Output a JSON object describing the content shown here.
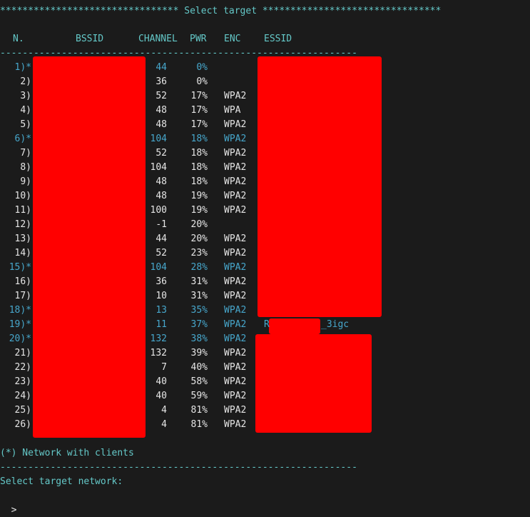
{
  "title": "******************************** Select target ********************************",
  "header": {
    "n": "N.",
    "bssid": "BSSID",
    "channel": "CHANNEL",
    "pwr": "PWR",
    "enc": "ENC",
    "essid": "ESSID"
  },
  "divider": "----------------------------------------------------------------",
  "rows": [
    {
      "n": "1)*",
      "channel": "44",
      "pwr": "0%",
      "enc": "",
      "clients": true
    },
    {
      "n": "2)",
      "channel": "36",
      "pwr": "0%",
      "enc": "",
      "clients": false
    },
    {
      "n": "3)",
      "channel": "52",
      "pwr": "17%",
      "enc": "WPA2",
      "clients": false
    },
    {
      "n": "4)",
      "channel": "48",
      "pwr": "17%",
      "enc": "WPA",
      "clients": false
    },
    {
      "n": "5)",
      "channel": "48",
      "pwr": "17%",
      "enc": "WPA2",
      "clients": false
    },
    {
      "n": "6)*",
      "channel": "104",
      "pwr": "18%",
      "enc": "WPA2",
      "clients": true
    },
    {
      "n": "7)",
      "channel": "52",
      "pwr": "18%",
      "enc": "WPA2",
      "clients": false
    },
    {
      "n": "8)",
      "channel": "104",
      "pwr": "18%",
      "enc": "WPA2",
      "clients": false
    },
    {
      "n": "9)",
      "channel": "48",
      "pwr": "18%",
      "enc": "WPA2",
      "clients": false
    },
    {
      "n": "10)",
      "channel": "48",
      "pwr": "19%",
      "enc": "WPA2",
      "clients": false
    },
    {
      "n": "11)",
      "channel": "100",
      "pwr": "19%",
      "enc": "WPA2",
      "clients": false
    },
    {
      "n": "12)",
      "channel": "-1",
      "pwr": "20%",
      "enc": "",
      "clients": false
    },
    {
      "n": "13)",
      "channel": "44",
      "pwr": "20%",
      "enc": "WPA2",
      "clients": false
    },
    {
      "n": "14)",
      "channel": "52",
      "pwr": "23%",
      "enc": "WPA2",
      "clients": false
    },
    {
      "n": "15)*",
      "channel": "104",
      "pwr": "28%",
      "enc": "WPA2",
      "clients": true
    },
    {
      "n": "16)",
      "channel": "36",
      "pwr": "31%",
      "enc": "WPA2",
      "clients": false
    },
    {
      "n": "17)",
      "channel": "10",
      "pwr": "31%",
      "enc": "WPA2",
      "clients": false
    },
    {
      "n": "18)*",
      "channel": "13",
      "pwr": "35%",
      "enc": "WPA2",
      "clients": true
    },
    {
      "n": "19)*",
      "channel": "11",
      "pwr": "37%",
      "enc": "WPA2",
      "clients": true,
      "essid_start": "R",
      "essid_end": "_3igc"
    },
    {
      "n": "20)*",
      "channel": "132",
      "pwr": "38%",
      "enc": "WPA2",
      "clients": true
    },
    {
      "n": "21)",
      "channel": "132",
      "pwr": "39%",
      "enc": "WPA2",
      "clients": false
    },
    {
      "n": "22)",
      "channel": "7",
      "pwr": "40%",
      "enc": "WPA2",
      "clients": false
    },
    {
      "n": "23)",
      "channel": "40",
      "pwr": "58%",
      "enc": "WPA2",
      "clients": false
    },
    {
      "n": "24)",
      "channel": "40",
      "pwr": "59%",
      "enc": "WPA2",
      "clients": false
    },
    {
      "n": "25)",
      "channel": "4",
      "pwr": "81%",
      "enc": "WPA2",
      "clients": false
    },
    {
      "n": "26)",
      "channel": "4",
      "pwr": "81%",
      "enc": "WPA2",
      "clients": false
    }
  ],
  "legend": "(*) Network with clients",
  "prompt": "Select target network:",
  "input_caret": ">",
  "colors": {
    "background": "#1b1b1b",
    "cyan": "#64c8c8",
    "highlight": "#47a7cc",
    "text": "#e6e6e6",
    "redaction": "#ff0000"
  }
}
